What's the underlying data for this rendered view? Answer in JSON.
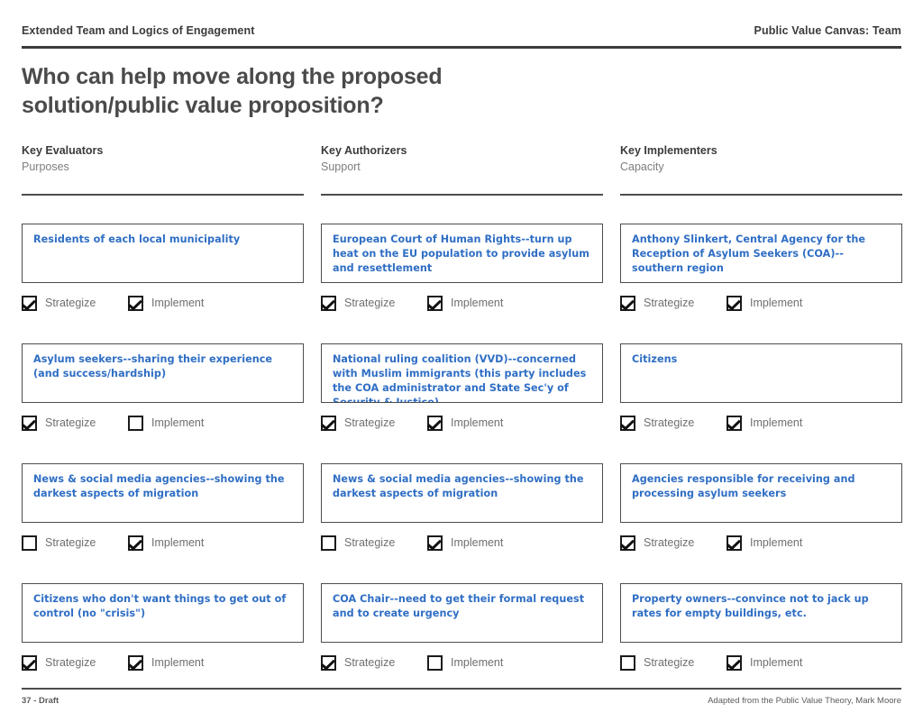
{
  "header": {
    "left": "Extended Team and Logics of Engagement",
    "right": "Public Value Canvas: Team"
  },
  "title": "Who can help move along the proposed solution/public value proposition?",
  "checkbox_labels": {
    "strategize": "Strategize",
    "implement": "Implement"
  },
  "colors": {
    "handwriting_blue": "#2f6ec4",
    "rule": "#4d4d4d",
    "label_gray": "#6f6f6f",
    "subtitle_gray": "#7d7d7d"
  },
  "columns": [
    {
      "title": "Key Evaluators",
      "subtitle": "Purposes",
      "cards": [
        {
          "text": "Residents of each local municipality",
          "strategize": true,
          "implement": true
        },
        {
          "text": "Asylum seekers--sharing their experience (and success/hardship)",
          "strategize": true,
          "implement": false
        },
        {
          "text": "News & social media agencies--showing the darkest aspects of migration",
          "strategize": false,
          "implement": true
        },
        {
          "text": "Citizens who don't want things to get out of control (no \"crisis\")",
          "strategize": true,
          "implement": true
        }
      ]
    },
    {
      "title": "Key Authorizers",
      "subtitle": "Support",
      "cards": [
        {
          "text": "European Court of Human Rights--turn up heat on the EU population to provide asylum and resettlement",
          "strategize": true,
          "implement": true
        },
        {
          "text": "National ruling coalition (VVD)--concerned with Muslim immigrants (this party includes the COA administrator and State Sec'y of Security & Justice)",
          "strategize": true,
          "implement": true
        },
        {
          "text": "News & social media agencies--showing the darkest aspects of migration",
          "strategize": false,
          "implement": true
        },
        {
          "text": "COA Chair--need to get their formal request and to create urgency",
          "strategize": true,
          "implement": false
        }
      ]
    },
    {
      "title": "Key Implementers",
      "subtitle": "Capacity",
      "cards": [
        {
          "text": "Anthony Slinkert, Central Agency for the Reception of Asylum Seekers (COA)-- southern region",
          "strategize": true,
          "implement": true
        },
        {
          "text": "Citizens",
          "strategize": true,
          "implement": true
        },
        {
          "text": "Agencies responsible for receiving and processing asylum seekers",
          "strategize": true,
          "implement": true
        },
        {
          "text": "Property owners--convince not to jack up rates for empty buildings, etc.",
          "strategize": false,
          "implement": true
        }
      ]
    }
  ],
  "footer": {
    "left": "37 - Draft",
    "right": "Adapted from the Public Value Theory, Mark Moore"
  }
}
